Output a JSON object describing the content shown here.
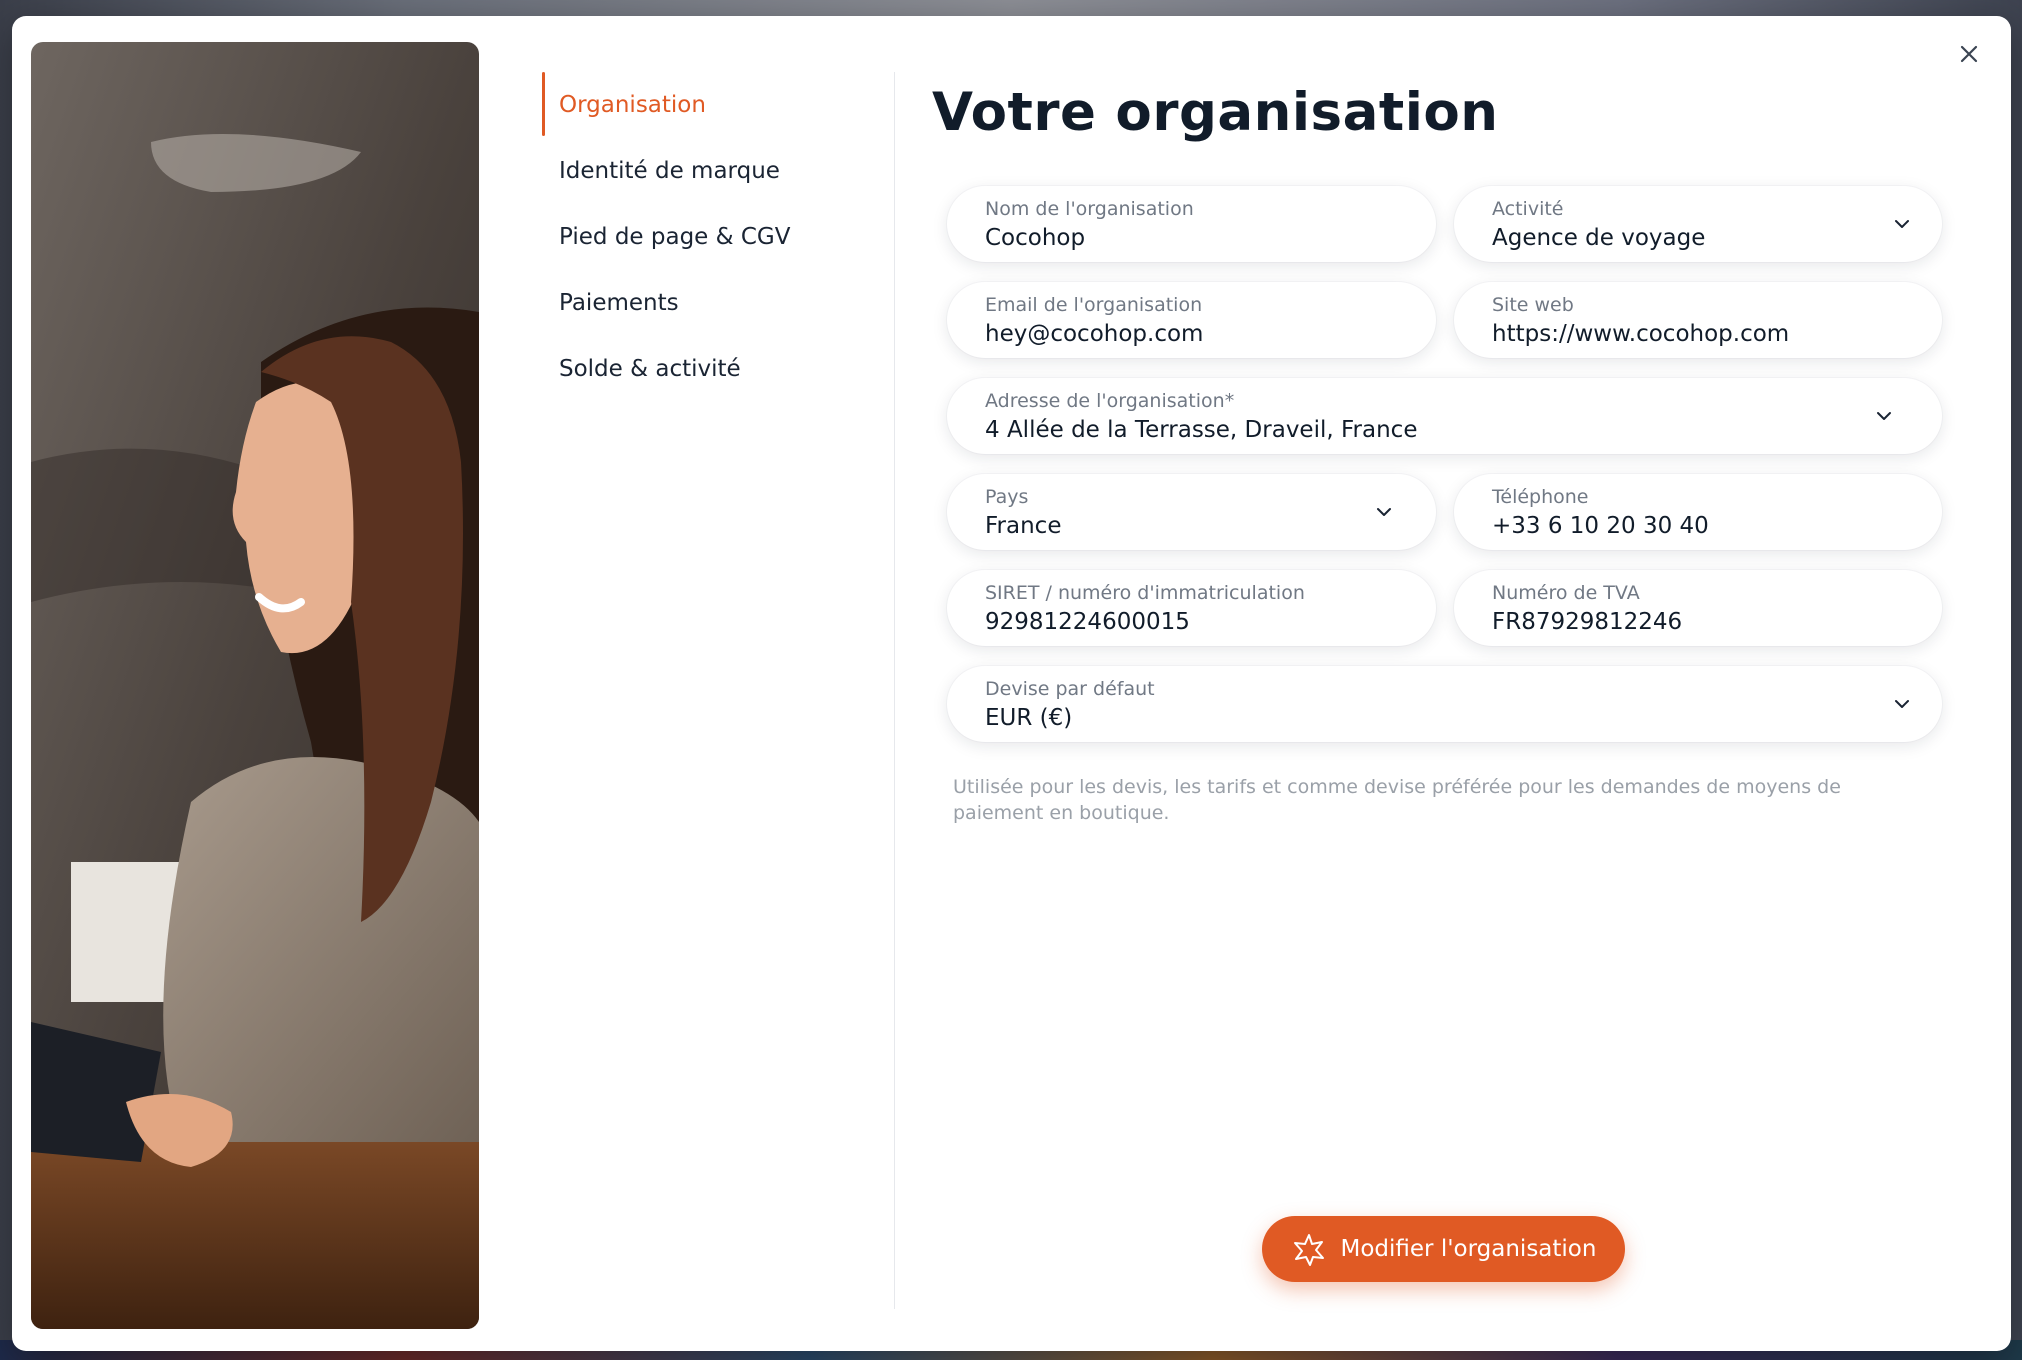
{
  "nav": {
    "items": [
      {
        "label": "Organisation",
        "active": true
      },
      {
        "label": "Identité de marque"
      },
      {
        "label": "Pied de page & CGV"
      },
      {
        "label": "Paiements"
      },
      {
        "label": "Solde & activité"
      }
    ]
  },
  "page_title": "Votre organisation",
  "form": {
    "org_name": {
      "label": "Nom de l'organisation",
      "value": "Cocohop"
    },
    "activity": {
      "label": "Activité",
      "value": "Agence de voyage"
    },
    "org_email": {
      "label": "Email de l'organisation",
      "value": "hey@cocohop.com"
    },
    "website": {
      "label": "Site web",
      "value": "https://www.cocohop.com"
    },
    "address": {
      "label": "Adresse de l'organisation*",
      "value": "4 Allée de la Terrasse, Draveil, France"
    },
    "country": {
      "label": "Pays",
      "value": "France"
    },
    "phone": {
      "label": "Téléphone",
      "value": "+33 6 10 20 30 40"
    },
    "siret": {
      "label": "SIRET / numéro d'immatriculation",
      "value": "92981224600015"
    },
    "vat": {
      "label": "Numéro de TVA",
      "value": "FR87929812246"
    },
    "currency": {
      "label": "Devise par défaut",
      "value": "EUR (€)"
    },
    "currency_hint": "Utilisée pour les devis, les tarifs et comme devise préférée pour les demandes de moyens de paiement en boutique."
  },
  "submit_label": "Modifier l'organisation",
  "icons": {
    "close": "close-icon",
    "chevron": "chevron-down-icon",
    "submit": "sparkle-icon"
  },
  "colors": {
    "accent": "#e05a24",
    "text": "#111c2a",
    "muted": "#707884"
  }
}
